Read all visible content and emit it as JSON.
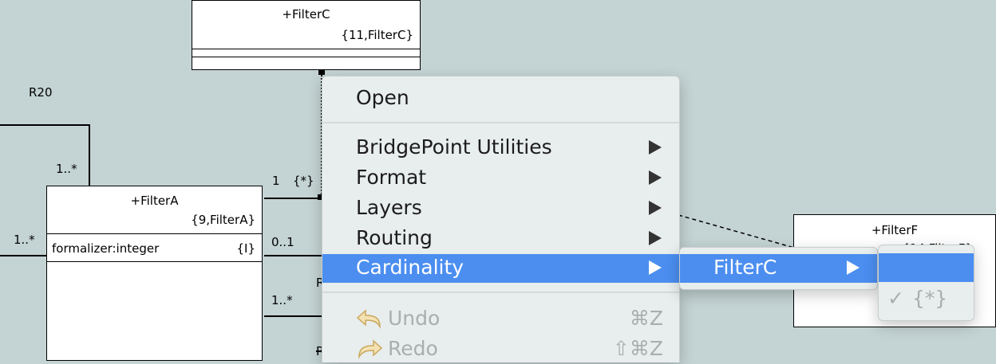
{
  "diagram": {
    "filter_c": {
      "name": "+FilterC",
      "key_letters": "{11,FilterC}"
    },
    "filter_a": {
      "name": "+FilterA",
      "key_letters": "{9,FilterA}",
      "attribute": "formalizer:integer",
      "attr_tag": "{I}"
    },
    "filter_f": {
      "name": "+FilterF",
      "key_letters_partial": "{14,FilterF}"
    },
    "labels": {
      "r20": "R20",
      "mult_1_star_top": "1..*",
      "mult_1_star_left": "1..*",
      "mult_1": "1",
      "mult_star_brace": "{*}",
      "mult_0_1": "0..1",
      "mult_1_star_bottom": "1..*",
      "edge_r1": "R",
      "edge_r2": "R"
    }
  },
  "context_menu": {
    "open": "Open",
    "bridgepoint_utilities": "BridgePoint Utilities",
    "format": "Format",
    "layers": "Layers",
    "routing": "Routing",
    "cardinality": "Cardinality",
    "undo": "Undo",
    "undo_shortcut": "⌘Z",
    "redo": "Redo",
    "redo_shortcut": "⇧⌘Z"
  },
  "submenu": {
    "filter_c": "FilterC"
  },
  "subsubmenu": {
    "empty_option": "",
    "star_option": "{*}",
    "checkmark": "✓"
  },
  "colors": {
    "canvas": "#c4d3d3",
    "menu_bg": "#e8eded",
    "selection": "#4b8ef0"
  }
}
